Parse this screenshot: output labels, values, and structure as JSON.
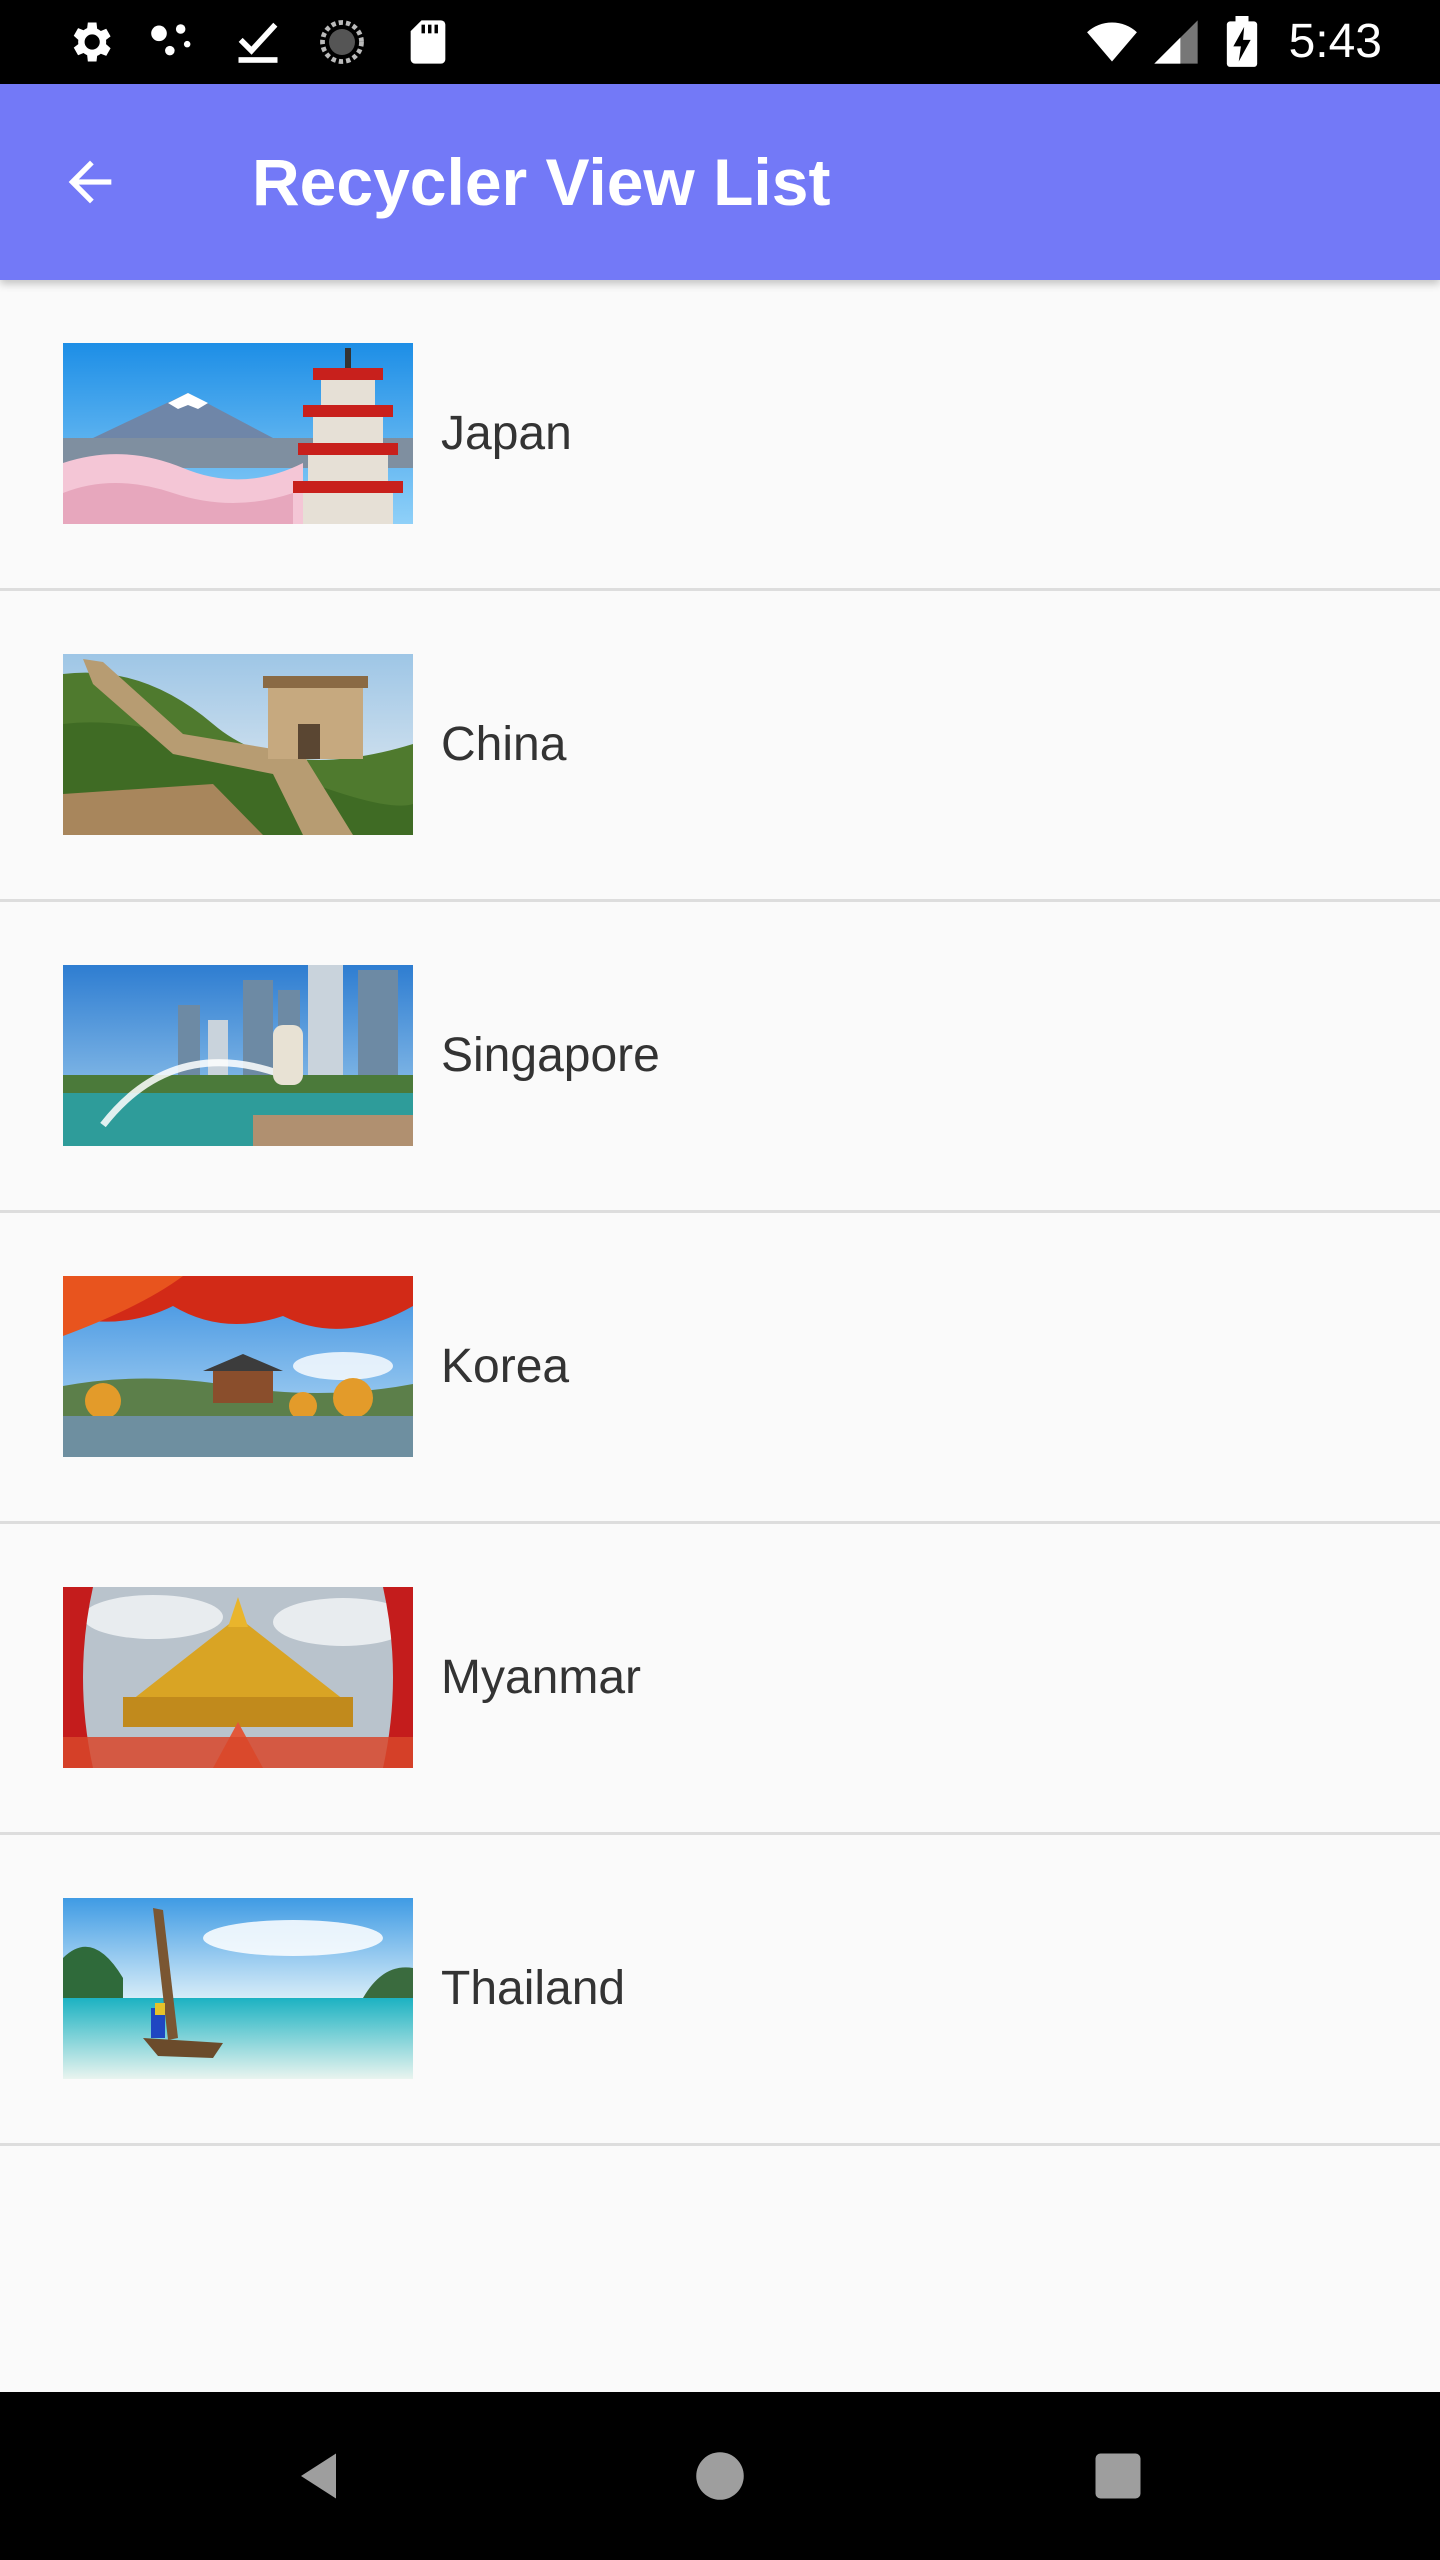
{
  "status_bar": {
    "time": "5:43",
    "left_icons": [
      "settings-icon",
      "dots-icon",
      "download-done-icon",
      "sync-icon",
      "sd-card-icon"
    ],
    "right_icons": [
      "wifi-icon",
      "signal-icon",
      "battery-charging-icon"
    ]
  },
  "app_bar": {
    "title": "Recycler View List",
    "back_icon": "arrow-back-icon",
    "background": "#7379f7"
  },
  "list": {
    "items": [
      {
        "label": "Japan",
        "image": "japan-photo"
      },
      {
        "label": "China",
        "image": "china-photo"
      },
      {
        "label": "Singapore",
        "image": "singapore-photo"
      },
      {
        "label": "Korea",
        "image": "korea-photo"
      },
      {
        "label": "Myanmar",
        "image": "myanmar-photo"
      },
      {
        "label": "Thailand",
        "image": "thailand-photo"
      }
    ]
  },
  "nav_bar": {
    "buttons": [
      "back-triangle-icon",
      "home-circle-icon",
      "recents-square-icon"
    ]
  }
}
